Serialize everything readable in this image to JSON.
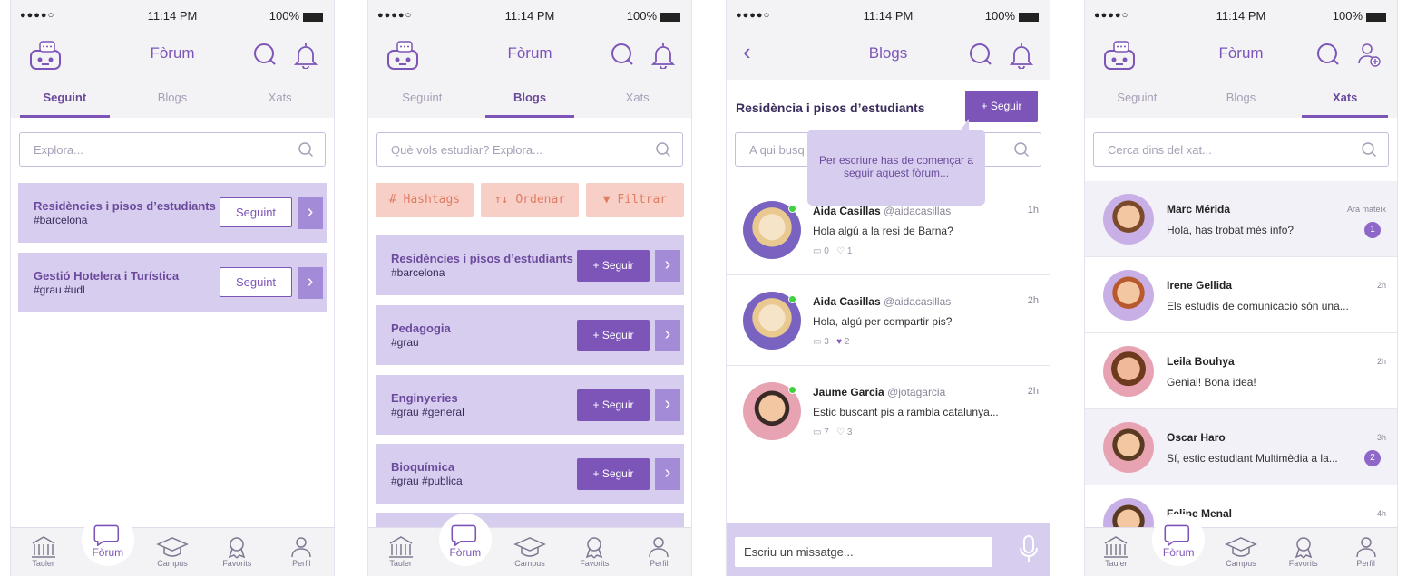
{
  "status": {
    "time": "11:14 PM",
    "battery": "100%",
    "signal": "●●●●○",
    "wifi": "ᯤ"
  },
  "screen1": {
    "nav_title": "Fòrum",
    "tabs": [
      "Seguint",
      "Blogs",
      "Xats"
    ],
    "search_placeholder": "Explora...",
    "cards": [
      {
        "title": "Residències i pisos d’estudiants",
        "tags": "#barcelona",
        "button": "Seguint"
      },
      {
        "title": "Gestió Hotelera i Turística",
        "tags": "#grau  #udl",
        "button": "Seguint"
      }
    ]
  },
  "screen2": {
    "nav_title": "Fòrum",
    "tabs": [
      "Seguint",
      "Blogs",
      "Xats"
    ],
    "search_placeholder": "Què vols estudiar? Explora...",
    "filters": [
      "# Hashtags",
      "↑↓ Ordenar",
      "Filtrar"
    ],
    "cards": [
      {
        "title": "Residències i pisos d’estudiants",
        "tags": "#barcelona",
        "button": "+ Seguir"
      },
      {
        "title": "Pedagogia",
        "tags": "#grau",
        "button": "+ Seguir"
      },
      {
        "title": "Enginyeries",
        "tags": "#grau  #general",
        "button": "+ Seguir"
      },
      {
        "title": "Bioquímica",
        "tags": "#grau  #publica",
        "button": "+ Seguir"
      }
    ]
  },
  "screen3": {
    "nav_title": "Blogs",
    "header_title": "Residència i pisos d’estudiants",
    "follow_button": "+ Seguir",
    "search_placeholder": "A qui busq",
    "tooltip": "Per escriure has de començar a seguir aquest fòrum...",
    "posts": [
      {
        "name": "Aida Casillas",
        "handle": "@aidacasillas",
        "time": "1h",
        "text": "Hola algú a la resi de Barna?",
        "comments": "0",
        "likes": "1"
      },
      {
        "name": "Aida Casillas",
        "handle": "@aidacasillas",
        "time": "2h",
        "text": "Hola, algú per compartir pis?",
        "comments": "3",
        "likes": "2"
      },
      {
        "name": "Jaume Garcia",
        "handle": "@jotagarcia",
        "time": "2h",
        "text": "Estic buscant pis a rambla catalunya...",
        "comments": "7",
        "likes": "3"
      }
    ],
    "composer_placeholder": "Escriu un missatge..."
  },
  "screen4": {
    "nav_title": "Fòrum",
    "tabs": [
      "Seguint",
      "Blogs",
      "Xats"
    ],
    "search_placeholder": "Cerca dins del xat...",
    "chats": [
      {
        "name": "Marc Mérida",
        "msg": "Hola, has trobat més info?",
        "time": "Ara mateix",
        "badge": "1"
      },
      {
        "name": "Irene Gellida",
        "msg": "Els estudis de comunicació són una...",
        "time": "2h",
        "badge": ""
      },
      {
        "name": "Leila Bouhya",
        "msg": "Genial! Bona idea!",
        "time": "2h",
        "badge": ""
      },
      {
        "name": "Oscar Haro",
        "msg": "Sí, estic estudiant Multimèdia a la...",
        "time": "3h",
        "badge": "2"
      },
      {
        "name": "Felipe Menal",
        "msg": "",
        "time": "4h",
        "badge": ""
      }
    ]
  },
  "bottom_nav": [
    "Tauler",
    "Fòrum",
    "Campus",
    "Favorits",
    "Perfil"
  ],
  "colors": {
    "accent": "#7d55b8",
    "card": "#d7cdef",
    "filter": "#f7cfc6",
    "online": "#3fd13f"
  }
}
